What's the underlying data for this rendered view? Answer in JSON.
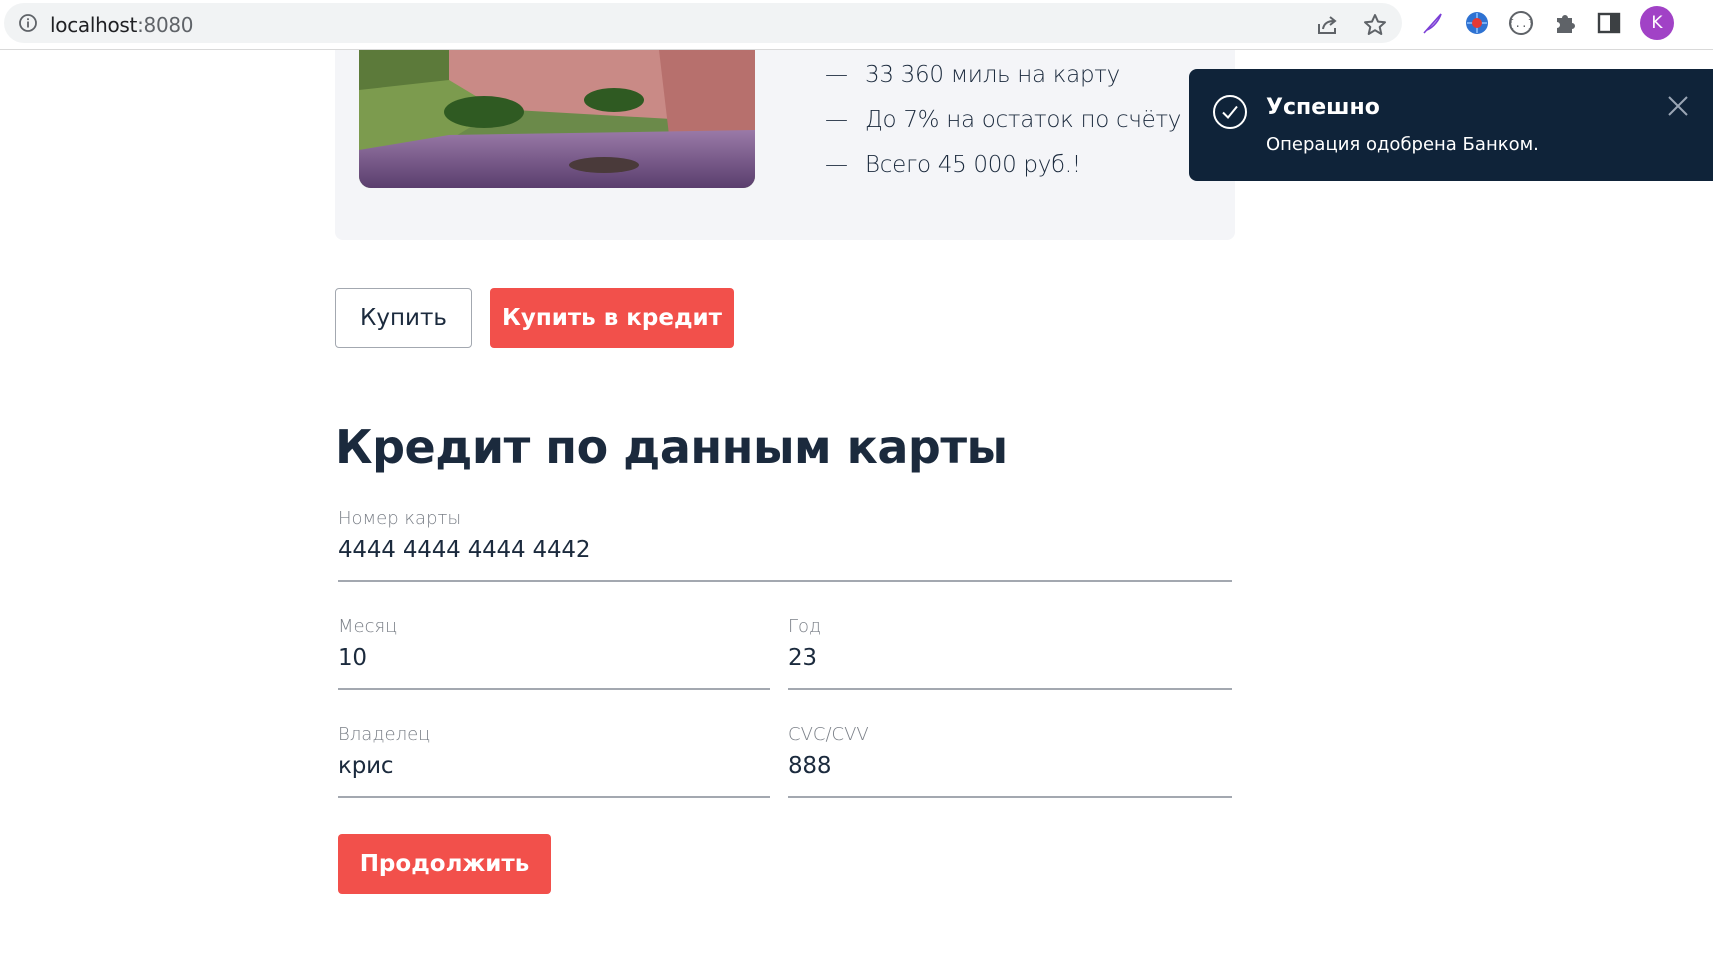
{
  "browser": {
    "host": "localhost",
    "port": ":8080",
    "avatar_letter": "K",
    "icons": [
      "info-icon",
      "share-icon",
      "star-icon",
      "feather-icon",
      "extension-globe-icon",
      "braces-icon",
      "puzzle-icon",
      "side-panel-icon"
    ]
  },
  "promo": {
    "features": [
      "33 360 миль на карту",
      "До 7% на остаток по счёту",
      "Всего 45 000 руб.!"
    ],
    "dash": "—"
  },
  "actions": {
    "buy_label": "Купить",
    "buy_credit_label": "Купить в кредит"
  },
  "form": {
    "title": "Кредит по данным карты",
    "card_number": {
      "label": "Номер карты",
      "value": "4444 4444 4444 4442"
    },
    "month": {
      "label": "Месяц",
      "value": "10"
    },
    "year": {
      "label": "Год",
      "value": "23"
    },
    "owner": {
      "label": "Владелец",
      "value": "крис"
    },
    "cvc": {
      "label": "CVC/CVV",
      "value": "888"
    },
    "continue_label": "Продолжить"
  },
  "notification": {
    "title": "Успешно",
    "message": "Операция одобрена Банком."
  },
  "colors": {
    "accent": "#f2504b",
    "text": "#1b2a3d",
    "toast_bg": "#0f2339",
    "avatar": "#a142c6"
  }
}
